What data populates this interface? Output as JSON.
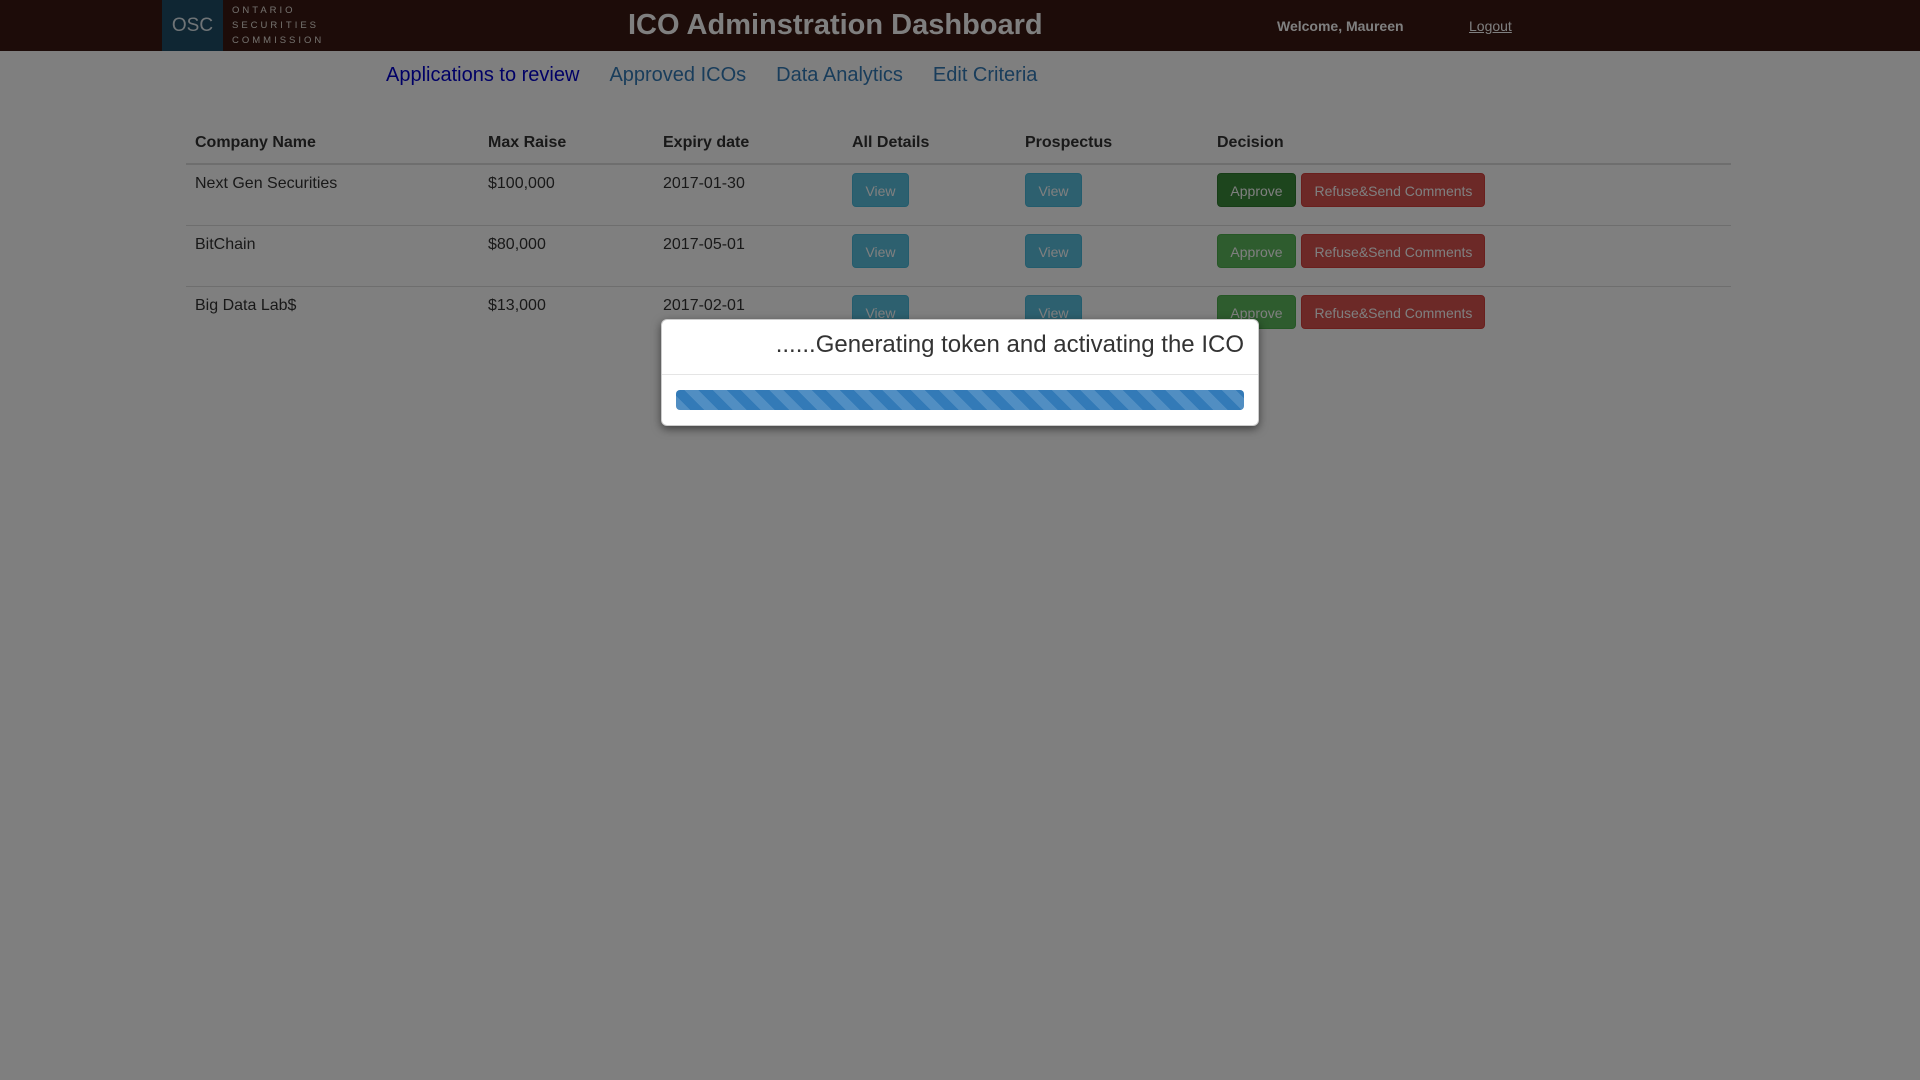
{
  "header": {
    "logo_abbr": "OSC",
    "logo_lines": [
      "ONTARIO",
      "SECURITIES",
      "COMMISSION"
    ],
    "title": "ICO Adminstration Dashboard",
    "welcome": "Welcome, Maureen",
    "logout": "Logout"
  },
  "nav": {
    "items": [
      {
        "label": "Applications to review",
        "active": true
      },
      {
        "label": "Approved ICOs",
        "active": false
      },
      {
        "label": "Data Analytics",
        "active": false
      },
      {
        "label": "Edit Criteria",
        "active": false
      }
    ]
  },
  "table": {
    "headers": [
      "Company Name",
      "Max Raise",
      "Expiry date",
      "All Details",
      "Prospectus",
      "Decision"
    ],
    "rows": [
      {
        "company": "Next Gen Securities",
        "max_raise": "$100,000",
        "expiry": "2017-01-30",
        "details_btn": "View",
        "prospectus_btn": "View",
        "approve_btn": "Approve",
        "refuse_btn": "Refuse&Send Comments"
      },
      {
        "company": "BitChain",
        "max_raise": "$80,000",
        "expiry": "2017-05-01",
        "details_btn": "View",
        "prospectus_btn": "View",
        "approve_btn": "Approve",
        "refuse_btn": "Refuse&Send Comments"
      },
      {
        "company": "Big Data Lab$",
        "max_raise": "$13,000",
        "expiry": "2017-02-01",
        "details_btn": "View",
        "prospectus_btn": "View",
        "approve_btn": "Approve",
        "refuse_btn": "Refuse&Send Comments"
      }
    ]
  },
  "modal": {
    "title": "......Generating token and activating the ICO",
    "progress_fraction": 1.0
  },
  "colors": {
    "header_bg": "#3a1912",
    "nav_link": "#337ab7",
    "nav_active": "#0000cc",
    "info": "#5bc0de",
    "success": "#5cb85c",
    "danger": "#d9534f",
    "progress": "#337ab7"
  }
}
